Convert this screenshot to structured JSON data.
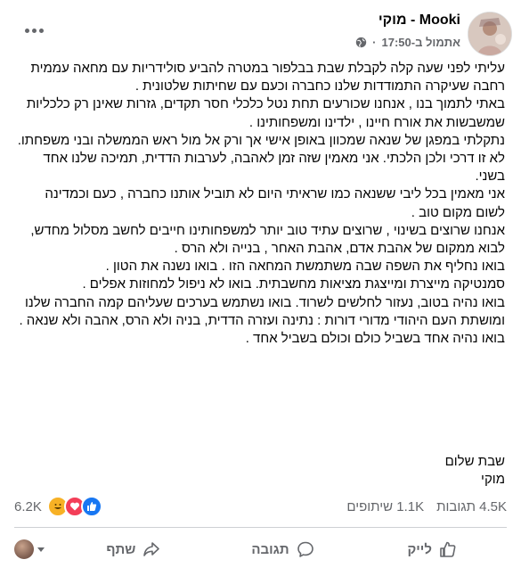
{
  "post": {
    "author": "Mooki - מוקי",
    "timestamp": "אתמול ב-17:50",
    "audience_icon": "globe-icon",
    "more_icon": "more-options-icon",
    "body_paragraphs": [
      "עליתי לפני שעה קלה לקבלת שבת בבלפור במטרה להביע סולידריות עם מחאה עממית רחבה שעיקרה התמודדות שלנו כחברה וכעם עם שחיתות שלטונית .",
      "באתי לתמוך בנו , אנחנו שכורעים תחת נטל כלכלי חסר תקדים, גזרות שאינן רק כלכליות שמשבשות את אורח חיינו , ילדינו ומשפחותינו .",
      "נתקלתי במפגן של שנאה שמכוון באופן אישי אך ורק אל מול ראש הממשלה ובני משפחתו.",
      "לא זו דרכי ולכן הלכתי. אני מאמין שזה זמן לאהבה, לערבות הדדית, תמיכה שלנו אחד בשני.",
      "אני מאמין בכל ליבי ששנאה כמו שראיתי היום לא תוביל אותנו כחברה , כעם וכמדינה לשום מקום טוב .",
      "אנחנו שרוצים בשינוי , שרוצים עתיד טוב יותר למשפחותינו חייבים לחשב מסלול מחדש, לבוא ממקום של אהבת אדם, אהבת האחר , בנייה ולא הרס .",
      "בואו נחליף את השפה שבה משתמשת המחאה הזו . בואו נשנה את הטון .",
      "סמנטיקה מייצרת ומייצגת מציאות מחשבתית. בואו לא ניפול למחוזות אפלים .",
      "בואו נהיה בטוב, נעזור לחלשים לשרוד. בואו נשתמש בערכים שעליהם קמה החברה שלנו ומושתת העם היהודי מדורי דורות : נתינה ועזרה הדדית, בניה ולא הרס, אהבה ולא שנאה .",
      "בואו נהיה אחד בשביל כולם וכולם בשביל אחד ."
    ],
    "signoff": [
      "שבת שלום",
      "מוקי"
    ]
  },
  "stats": {
    "reactions_count": "6.2K",
    "reaction_icons": [
      "like-icon",
      "love-icon",
      "haha-icon"
    ],
    "comments": "4.5K תגובות",
    "shares": "1.1K שיתופים"
  },
  "actions": {
    "like": "לייק",
    "comment": "תגובה",
    "share": "שתף"
  },
  "colors": {
    "secondary_text": "#65676b",
    "like_blue": "#1877f2",
    "love_red": "#f33e58",
    "haha_yellow": "#f7b125",
    "divider": "#ced0d4"
  }
}
